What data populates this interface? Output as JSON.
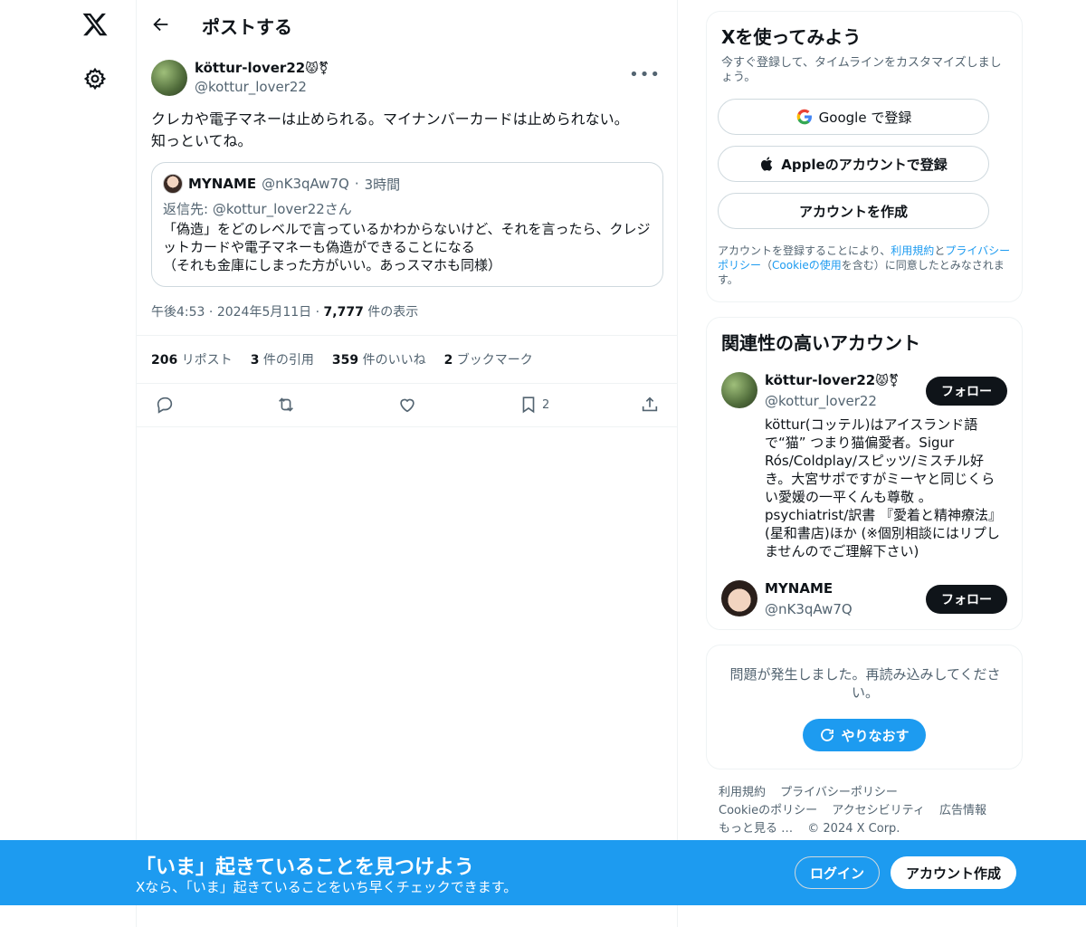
{
  "nav": {
    "logo": "x-logo",
    "settings_icon": "gear-icon"
  },
  "header": {
    "title": "ポストする"
  },
  "post": {
    "author_name": "köttur-lover22",
    "author_emoji": "😾⚧",
    "author_handle": "@kottur_lover22",
    "text_line1": "クレカや電子マネーは止められる。マイナンバーカードは止められない。",
    "text_line2": "知っといてね。",
    "quote": {
      "name": "MYNAME",
      "handle": "@nK3qAw7Q",
      "separator": "·",
      "time": "3時間",
      "reply_to": "返信先: @kottur_lover22さん",
      "line1": "「偽造」をどのレベルで言っているかわからないけど、それを言ったら、クレジ",
      "line2": "ットカードや電子マネーも偽造ができることになる",
      "line3": "（それも金庫にしまった方がいい。あっスマホも同様）"
    },
    "time": "午後4:53",
    "date": "2024年5月11日",
    "dot": "·",
    "views": "7,777",
    "views_label": "件の表示",
    "stats": {
      "reposts": "206",
      "reposts_label": "リポスト",
      "quotes": "3",
      "quotes_label": "件の引用",
      "likes": "359",
      "likes_label": "件のいいね",
      "bookmarks": "2",
      "bookmarks_label": "ブックマーク"
    },
    "bookmark_count": "2"
  },
  "signup": {
    "title": "Xを使ってみよう",
    "subtitle": "今すぐ登録して、タイムラインをカスタマイズしましょう。",
    "google_label": "Google で登録",
    "apple_label": "Appleのアカウントで登録",
    "create_label": "アカウントを作成",
    "terms_1": "アカウントを登録することにより、",
    "terms_link1": "利用規約",
    "terms_2": "と",
    "terms_link2": "プライバシーポリシー",
    "terms_3": "（",
    "terms_link3": "Cookieの使用",
    "terms_4": "を含む）に同意したとみなされます。"
  },
  "related": {
    "title": "関連性の高いアカウント",
    "accounts": [
      {
        "name": "köttur-lover22",
        "emoji": "😾⚧",
        "handle": "@kottur_lover22",
        "follow": "フォロー",
        "bio": "köttur(コッテル)はアイスランド語で“猫” つまり猫偏愛者。Sigur Rós/Coldplay/スピッツ/ミスチル好き。大宮サポですがミーヤと同じくらい愛媛の一平くんも尊敬 。psychiatrist/訳書 『愛着と精神療法』(星和書店)ほか (※個別相談にはリプしませんのでご理解下さい)"
      },
      {
        "name": "MYNAME",
        "handle": "@nK3qAw7Q",
        "follow": "フォロー"
      }
    ]
  },
  "error": {
    "message": "問題が発生しました。再読み込みしてください。",
    "retry_label": "やりなおす"
  },
  "footer": {
    "links": [
      "利用規約",
      "プライバシーポリシー",
      "Cookieのポリシー",
      "アクセシビリティ",
      "広告情報",
      "もっと見る …"
    ],
    "copyright": "© 2024 X Corp."
  },
  "banner": {
    "title": "「いま」起きていることを見つけよう",
    "subtitle": "Xなら、「いま」起きていることをいち早くチェックできます。",
    "login_label": "ログイン",
    "create_label": "アカウント作成"
  },
  "colors": {
    "accent": "#1d9bf0",
    "text": "#0f1419",
    "secondary": "#536471"
  }
}
